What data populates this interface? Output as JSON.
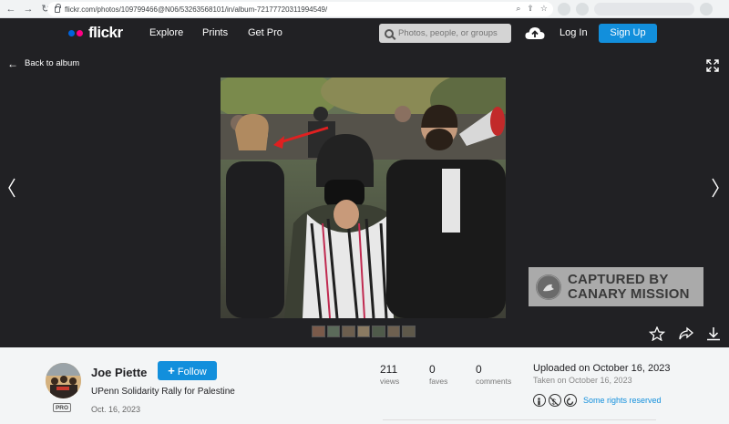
{
  "browser": {
    "url": "flickr.com/photos/109799466@N06/53263568101/in/album-72177720311994549/"
  },
  "header": {
    "logo": "flickr",
    "nav": [
      "Explore",
      "Prints",
      "Get Pro"
    ],
    "search_placeholder": "Photos, people, or groups",
    "login": "Log In",
    "signup": "Sign Up"
  },
  "photo_view": {
    "back_label": "Back to album",
    "watermark_line1": "CAPTURED BY",
    "watermark_line2": "CANARY MISSION",
    "thumbnail_count": 7
  },
  "info": {
    "author": "Joe Piette",
    "pro_badge": "PRO",
    "follow_label": "Follow",
    "title": "UPenn Solidarity Rally for Palestine",
    "date": "Oct. 16, 2023",
    "stats": [
      {
        "value": "211",
        "label": "views"
      },
      {
        "value": "0",
        "label": "faves"
      },
      {
        "value": "0",
        "label": "comments"
      }
    ],
    "uploaded": "Uploaded on October 16, 2023",
    "taken": "Taken on October 16, 2023",
    "rights": "Some rights reserved"
  },
  "colors": {
    "dark_bg": "#212124",
    "accent_blue": "#128fdc",
    "flickr_blue": "#0063dc",
    "flickr_pink": "#ff0084"
  }
}
